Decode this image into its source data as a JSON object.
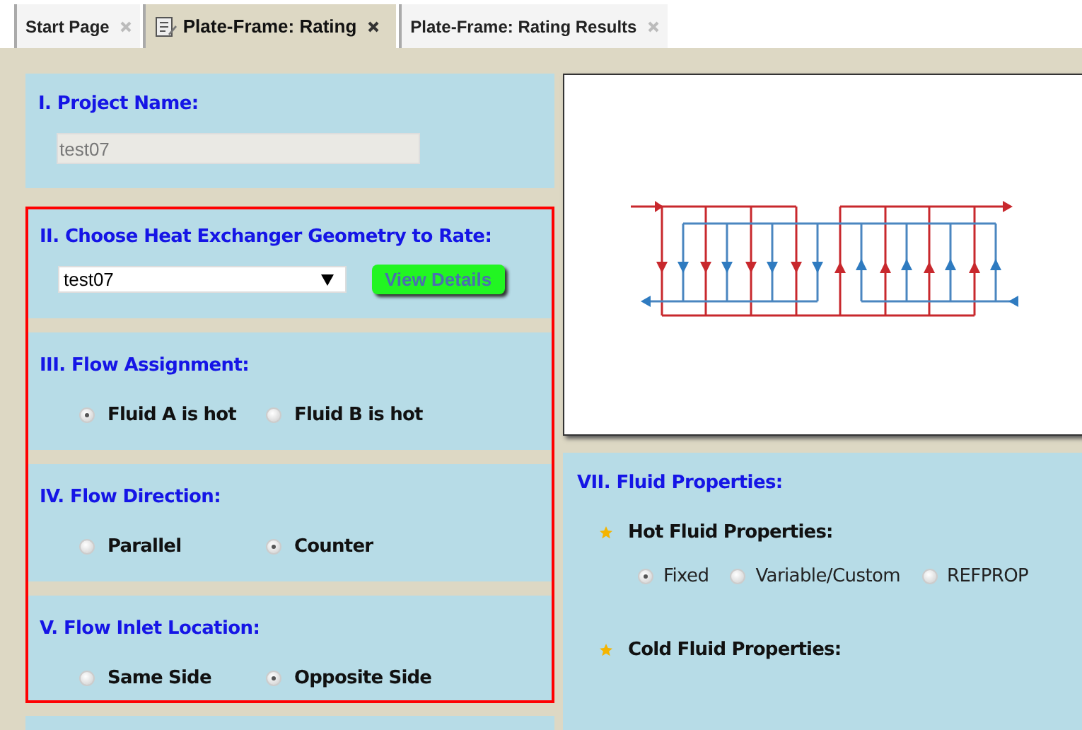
{
  "tabs": [
    {
      "label": "Start Page",
      "selected": false,
      "has_icon": false
    },
    {
      "label": "Plate-Frame: Rating",
      "selected": true,
      "has_icon": true
    },
    {
      "label": "Plate-Frame: Rating Results",
      "selected": false,
      "has_icon": false
    }
  ],
  "project": {
    "title": "I. Project Name:",
    "value": "test07"
  },
  "geometry": {
    "title": "II. Choose Heat Exchanger Geometry to Rate:",
    "value": "test07",
    "button": "View Details"
  },
  "radio_sections": [
    {
      "title": "III. Flow Assignment:",
      "options": [
        {
          "label": "Fluid A is hot",
          "selected": true
        },
        {
          "label": "Fluid B is hot",
          "selected": false
        }
      ]
    },
    {
      "title": "IV. Flow Direction:",
      "options": [
        {
          "label": "Parallel",
          "selected": false
        },
        {
          "label": "Counter",
          "selected": true
        }
      ]
    },
    {
      "title": "V. Flow Inlet Location:",
      "options": [
        {
          "label": "Same Side",
          "selected": false
        },
        {
          "label": "Opposite Side",
          "selected": true
        }
      ]
    }
  ],
  "fluid_properties": {
    "title": "VII. Fluid Properties:",
    "groups": [
      {
        "label": "Hot Fluid Properties:",
        "options": [
          {
            "label": "Fixed",
            "selected": true
          },
          {
            "label": "Variable/Custom",
            "selected": false
          },
          {
            "label": "REFPROP",
            "selected": false
          }
        ]
      },
      {
        "label": "Cold Fluid Properties:"
      }
    ]
  }
}
